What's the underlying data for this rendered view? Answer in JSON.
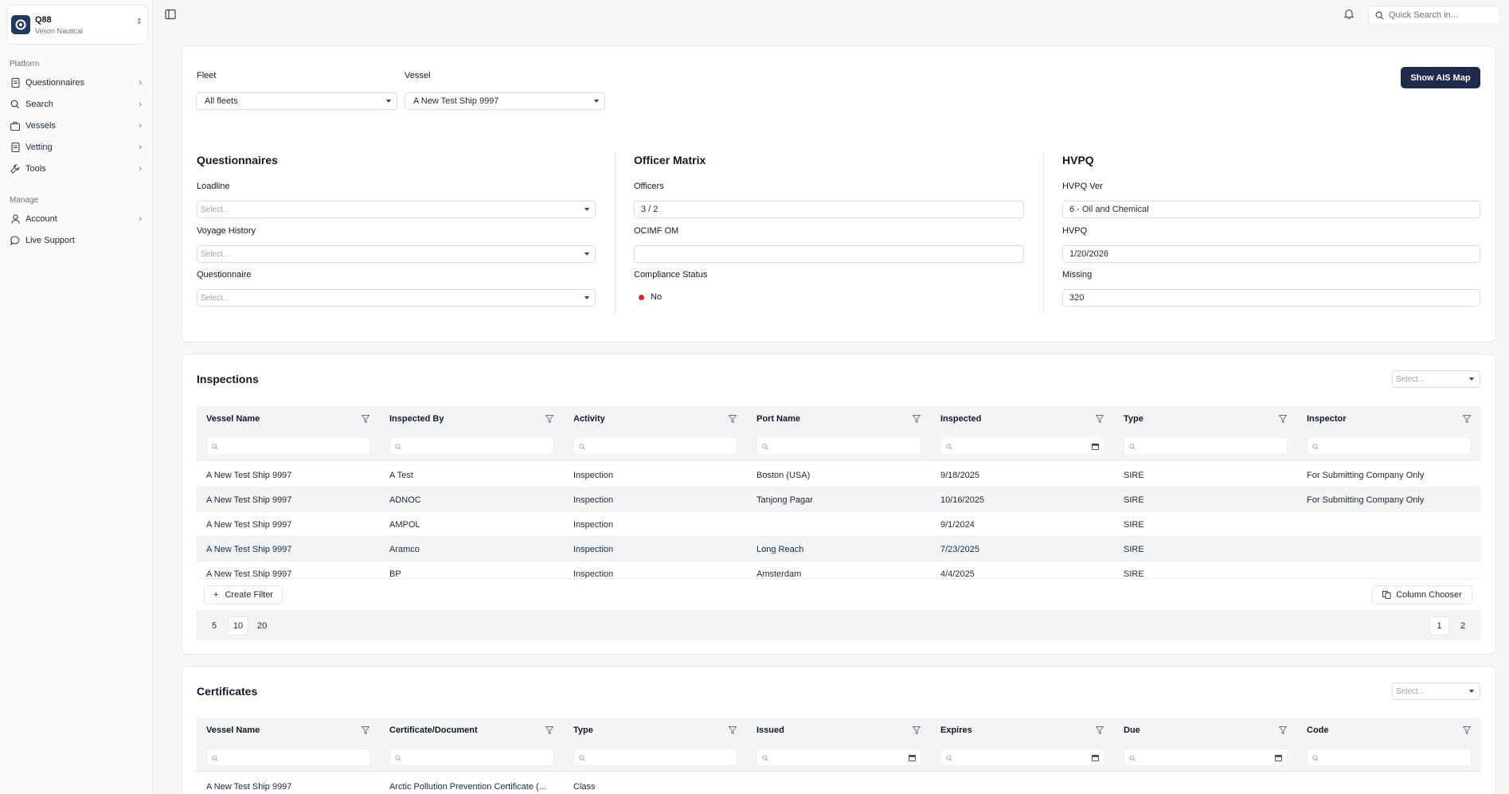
{
  "org": {
    "name": "Q88",
    "subtitle": "Veson Nautical"
  },
  "sidebar": {
    "platform_label": "Platform",
    "platform_items": [
      {
        "label": "Questionnaires",
        "icon": "document-icon"
      },
      {
        "label": "Search",
        "icon": "search-icon"
      },
      {
        "label": "Vessels",
        "icon": "briefcase-icon"
      },
      {
        "label": "Vetting",
        "icon": "document-icon"
      },
      {
        "label": "Tools",
        "icon": "wrench-icon"
      }
    ],
    "manage_label": "Manage",
    "manage_items": [
      {
        "label": "Account",
        "icon": "user-icon"
      },
      {
        "label": "Live Support",
        "icon": "chat-icon"
      }
    ]
  },
  "topbar": {
    "search_placeholder": "Quick Search in..."
  },
  "filters": {
    "fleet_label": "Fleet",
    "fleet_value": "All fleets",
    "vessel_label": "Vessel",
    "vessel_value": "A New Test Ship 9997",
    "ais_button": "Show AIS Map"
  },
  "questionnaires": {
    "title": "Questionnaires",
    "loadline_label": "Loadline",
    "loadline_placeholder": "Select...",
    "voyage_label": "Voyage History",
    "voyage_placeholder": "Select...",
    "questionnaire_label": "Questionnaire",
    "questionnaire_placeholder": "Select..."
  },
  "officer_matrix": {
    "title": "Officer Matrix",
    "officers_label": "Officers",
    "officers_value": "3 / 2",
    "ocimf_label": "OCIMF OM",
    "ocimf_value": "",
    "compliance_label": "Compliance Status",
    "compliance_value": "No",
    "compliance_color": "#dc2626"
  },
  "hvpq": {
    "title": "HVPQ",
    "ver_label": "HVPQ Ver",
    "ver_value": "6 - Oil and Chemical",
    "hvpq_label": "HVPQ",
    "hvpq_value": "1/20/2026",
    "missing_label": "Missing",
    "missing_value": "320"
  },
  "inspections": {
    "title": "Inspections",
    "select_placeholder": "Select...",
    "columns": [
      "Vessel Name",
      "Inspected By",
      "Activity",
      "Port Name",
      "Inspected",
      "Type",
      "Inspector"
    ],
    "rows": [
      [
        "A New Test Ship 9997",
        "A Test",
        "Inspection",
        "Boston (USA)",
        "9/18/2025",
        "SIRE",
        "For Submitting Company Only"
      ],
      [
        "A New Test Ship 9997",
        "ADNOC",
        "Inspection",
        "Tanjong Pagar",
        "10/16/2025",
        "SIRE",
        "For Submitting Company Only"
      ],
      [
        "A New Test Ship 9997",
        "AMPOL",
        "Inspection",
        "",
        "9/1/2024",
        "SIRE",
        ""
      ],
      [
        "A New Test Ship 9997",
        "Aramco",
        "Inspection",
        "Long Reach",
        "7/23/2025",
        "SIRE",
        ""
      ],
      [
        "A New Test Ship 9997",
        "BP",
        "Inspection",
        "Amsterdam",
        "4/4/2025",
        "SIRE",
        ""
      ]
    ],
    "create_filter": "Create Filter",
    "column_chooser": "Column Chooser",
    "page_sizes": [
      "5",
      "10",
      "20"
    ],
    "pages": [
      "1",
      "2"
    ]
  },
  "certificates": {
    "title": "Certificates",
    "select_placeholder": "Select...",
    "columns": [
      "Vessel Name",
      "Certificate/Document",
      "Type",
      "Issued",
      "Expires",
      "Due",
      "Code"
    ],
    "rows": [
      [
        "A New Test Ship 9997",
        "Arctic Pollution Prevention Certificate (...",
        "Class",
        "",
        "",
        "",
        ""
      ]
    ]
  }
}
